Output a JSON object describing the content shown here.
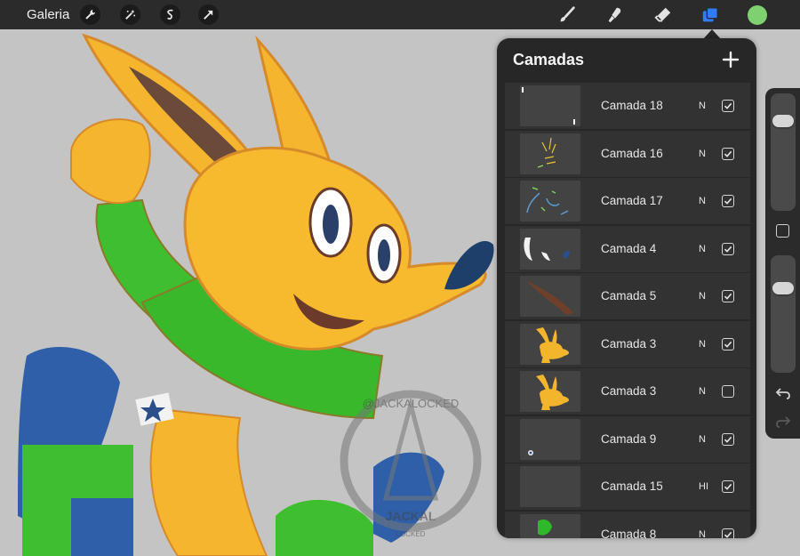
{
  "toolbar": {
    "gallery_label": "Galeria",
    "left_tools": [
      "wrench-icon",
      "magic-wand-icon",
      "selection-icon",
      "transform-arrow-icon"
    ],
    "right_tools": [
      "brush-icon",
      "smudge-icon",
      "eraser-icon",
      "layers-icon"
    ],
    "active_tool": "layers-icon",
    "active_color": "#7fd06e",
    "accent": "#2f7df6"
  },
  "layers_panel": {
    "title": "Camadas",
    "add_icon": "plus-icon",
    "layers": [
      {
        "name": "Camada 18",
        "mode": "N",
        "visible": true,
        "thumb": "specks"
      },
      {
        "name": "Camada 16",
        "mode": "N",
        "visible": true,
        "thumb": "yellow-lines"
      },
      {
        "name": "Camada 17",
        "mode": "N",
        "visible": true,
        "thumb": "blue-green-lines"
      },
      {
        "name": "Camada 4",
        "mode": "N",
        "visible": true,
        "thumb": "white-blue-shapes"
      },
      {
        "name": "Camada 5",
        "mode": "N",
        "visible": true,
        "thumb": "brown-ear"
      },
      {
        "name": "Camada 3",
        "mode": "N",
        "visible": true,
        "thumb": "yellow-rabbit"
      },
      {
        "name": "Camada 3",
        "mode": "N",
        "visible": false,
        "thumb": "yellow-rabbit"
      },
      {
        "name": "Camada 9",
        "mode": "N",
        "visible": true,
        "thumb": "small-dot"
      },
      {
        "name": "Camada 15",
        "mode": "HI",
        "visible": true,
        "thumb": "empty"
      },
      {
        "name": "Camada 8",
        "mode": "N",
        "visible": true,
        "thumb": "green-shape"
      }
    ]
  },
  "sidebar": {
    "brush_size_level": 0.8,
    "opacity_level": 0.75,
    "icons": [
      "square-modify-icon",
      "undo-icon",
      "redo-icon"
    ]
  },
  "watermark": {
    "handle": "@JACKALOCKED",
    "brand": "JACKAL",
    "sub": "LOCKED"
  }
}
